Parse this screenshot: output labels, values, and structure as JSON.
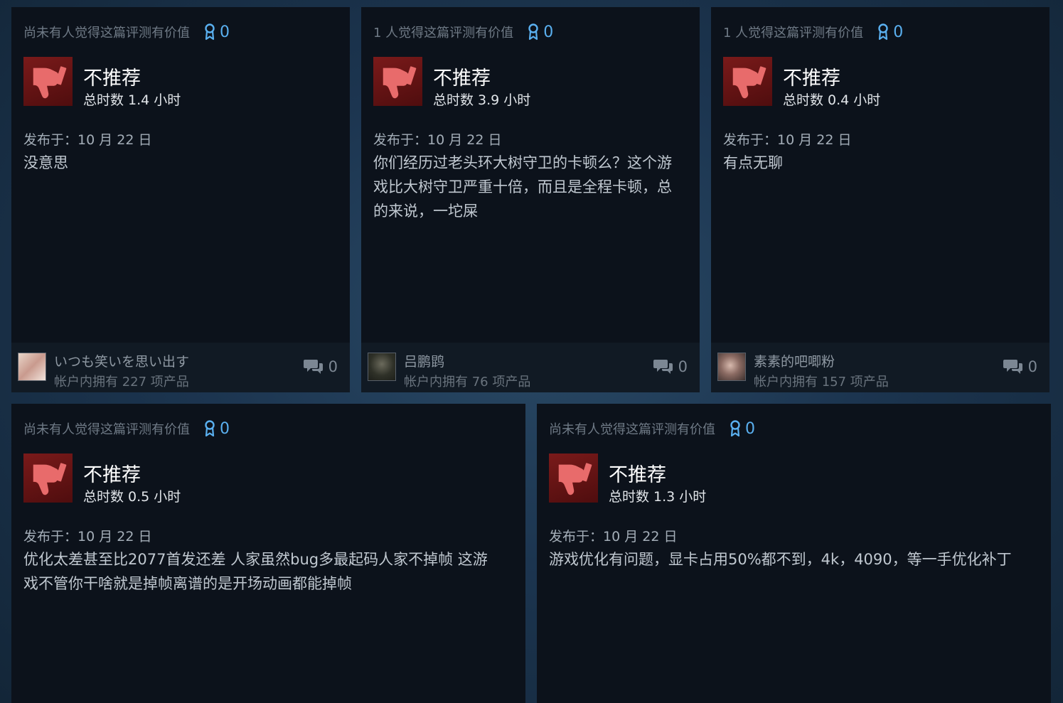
{
  "colors": {
    "page_bg": "#1c3550",
    "card_bg": "#0c121b",
    "footer_bg": "#111a24",
    "award": "#5ab0f0",
    "thumb_bg": "#6b1516"
  },
  "reviews": [
    {
      "helpful": "尚未有人觉得这篇评测有价值",
      "awards": "0",
      "verdict": "不推荐",
      "hours": "总时数 1.4 小时",
      "posted": "发布于：10 月 22 日",
      "lines": [
        "没意思"
      ],
      "author": "いつも笑いを思い出す",
      "owned": "帐户内拥有 227 项产品",
      "comments": "0"
    },
    {
      "helpful": "1 人觉得这篇评测有价值",
      "awards": "0",
      "verdict": "不推荐",
      "hours": "总时数 3.9 小时",
      "posted": "发布于：10 月 22 日",
      "lines": [
        "你们经历过老头环大树守卫的卡顿么？这个游",
        "戏比大树守卫严重十倍，而且是全程卡顿，总",
        "的来说，一坨屎"
      ],
      "author": "吕鹏鹍",
      "owned": "帐户内拥有 76 项产品",
      "comments": "0"
    },
    {
      "helpful": "1 人觉得这篇评测有价值",
      "awards": "0",
      "verdict": "不推荐",
      "hours": "总时数 0.4 小时",
      "posted": "发布于：10 月 22 日",
      "lines": [
        "有点无聊"
      ],
      "author": "素素的吧唧粉",
      "owned": "帐户内拥有 157 项产品",
      "comments": "0"
    },
    {
      "helpful": "尚未有人觉得这篇评测有价值",
      "awards": "0",
      "verdict": "不推荐",
      "hours": "总时数 0.5 小时",
      "posted": "发布于：10 月 22 日",
      "lines": [
        "优化太差甚至比2077首发还差 人家虽然bug多最起码人家不掉帧 这游",
        "戏不管你干啥就是掉帧离谱的是开场动画都能掉帧"
      ]
    },
    {
      "helpful": "尚未有人觉得这篇评测有价值",
      "awards": "0",
      "verdict": "不推荐",
      "hours": "总时数 1.3 小时",
      "posted": "发布于：10 月 22 日",
      "lines": [
        "游戏优化有问题，显卡占用50%都不到，4k，4090，等一手优化补丁"
      ]
    }
  ]
}
